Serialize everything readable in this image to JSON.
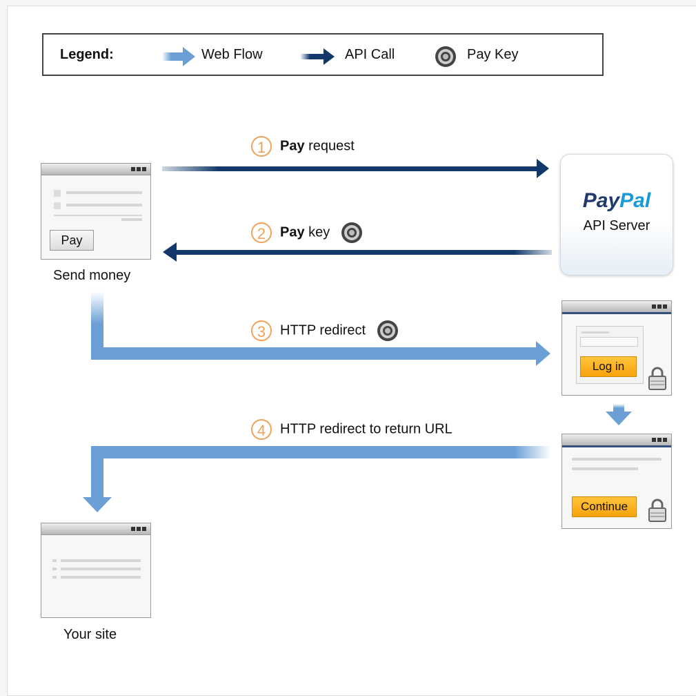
{
  "legend": {
    "title": "Legend:",
    "items": [
      {
        "label": "Web Flow",
        "icon": "light-blue-arrow-icon"
      },
      {
        "label": "API Call",
        "icon": "dark-blue-arrow-icon"
      },
      {
        "label": "Pay Key",
        "icon": "pay-key-icon"
      }
    ]
  },
  "steps": [
    {
      "number": "1",
      "bold": "Pay",
      "text": " request"
    },
    {
      "number": "2",
      "bold": "Pay",
      "text": " key"
    },
    {
      "number": "3",
      "bold": "",
      "text": "HTTP redirect"
    },
    {
      "number": "4",
      "bold": "",
      "text": "HTTP redirect to return URL"
    }
  ],
  "nodes": {
    "send_money": {
      "button": "Pay",
      "caption": "Send money"
    },
    "api_server": {
      "logo_pay": "Pay",
      "logo_pal": "Pal",
      "label": "API Server"
    },
    "login": {
      "button": "Log in"
    },
    "continue": {
      "button": "Continue"
    },
    "your_site": {
      "caption": "Your site"
    }
  },
  "colors": {
    "api_arrow": "#12386b",
    "web_arrow": "#6b9fd6",
    "step_circle": "#f0a15a",
    "button_orange": "#f7a30b"
  }
}
